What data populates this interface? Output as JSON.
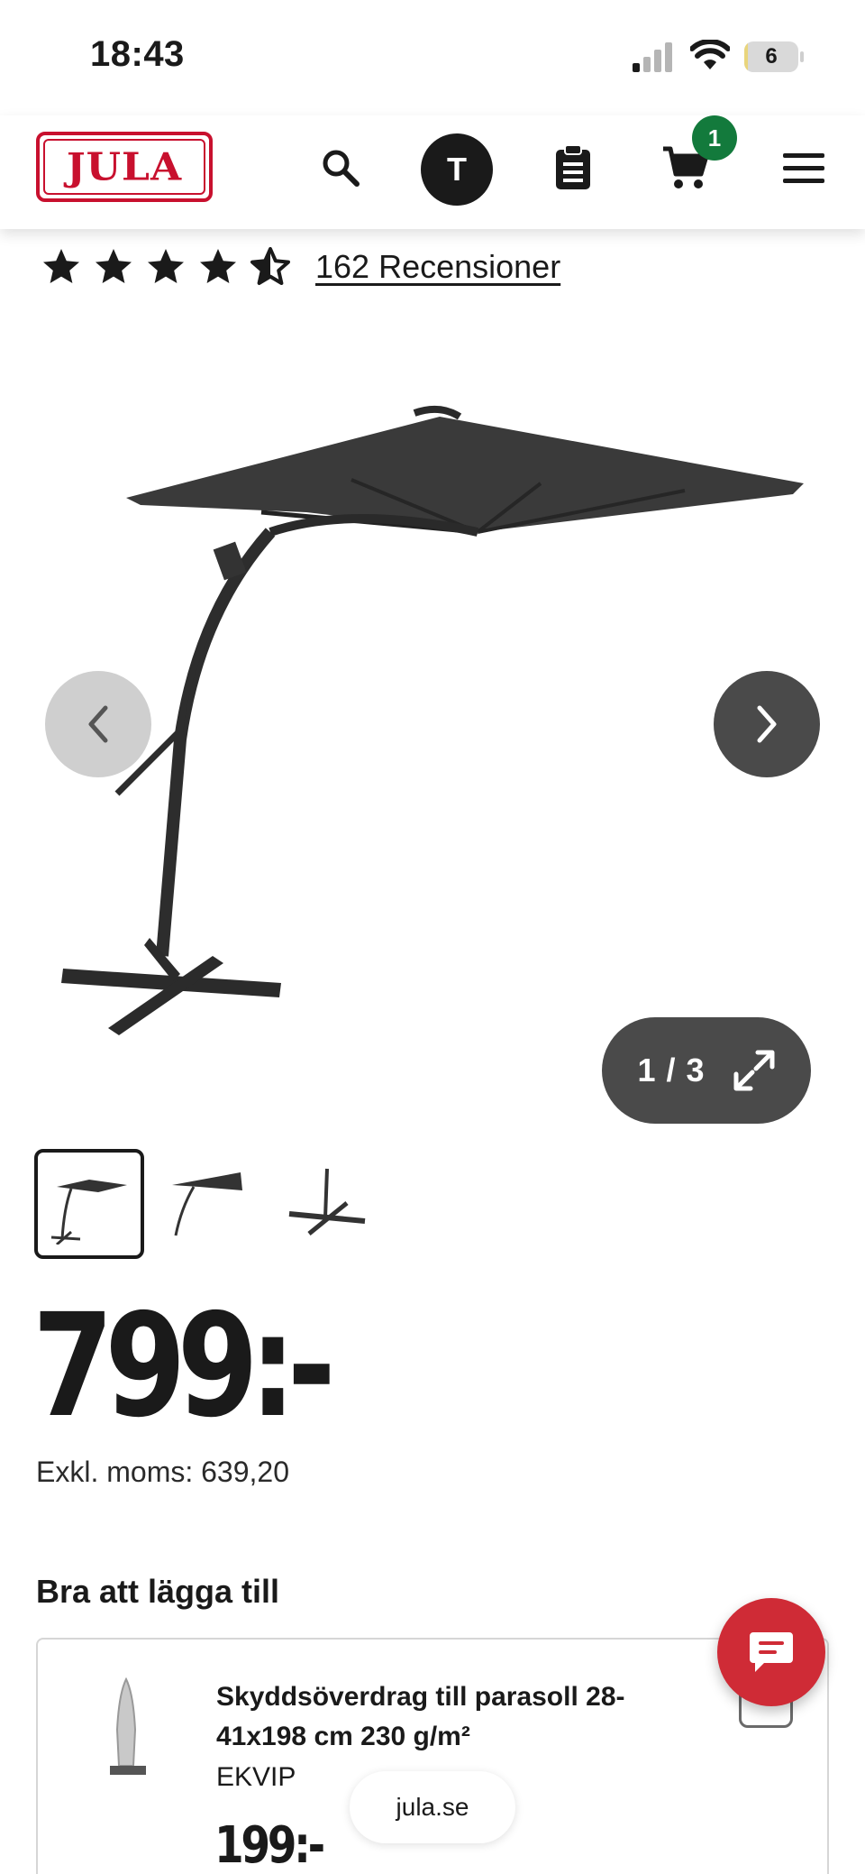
{
  "status_bar": {
    "time": "18:43",
    "battery_level": "6",
    "battery_fraction": 0.06
  },
  "header": {
    "logo_text": "JULA",
    "avatar_initial": "T",
    "cart_count": "1",
    "brand_color": "#c8102e",
    "cart_badge_color": "#137a3c",
    "icons": [
      "search-icon",
      "clipboard-list-icon",
      "cart-icon",
      "menu-icon"
    ]
  },
  "rating": {
    "stars": 4.5,
    "reviews_label": "162 Recensioner"
  },
  "gallery": {
    "counter": "1 / 3",
    "total_images": 3,
    "current_image": 1
  },
  "product": {
    "price": "799:-",
    "vat_line": "Exkl. moms: 639,20"
  },
  "addons": {
    "title": "Bra att lägga till",
    "items": [
      {
        "name": "Skyddsöverdrag till parasoll 28-41x198 cm 230 g/m²",
        "brand": "EKVIP",
        "price": "199:-"
      }
    ]
  },
  "chat": {
    "color": "#cf2b36"
  },
  "browser": {
    "url": "jula.se"
  }
}
